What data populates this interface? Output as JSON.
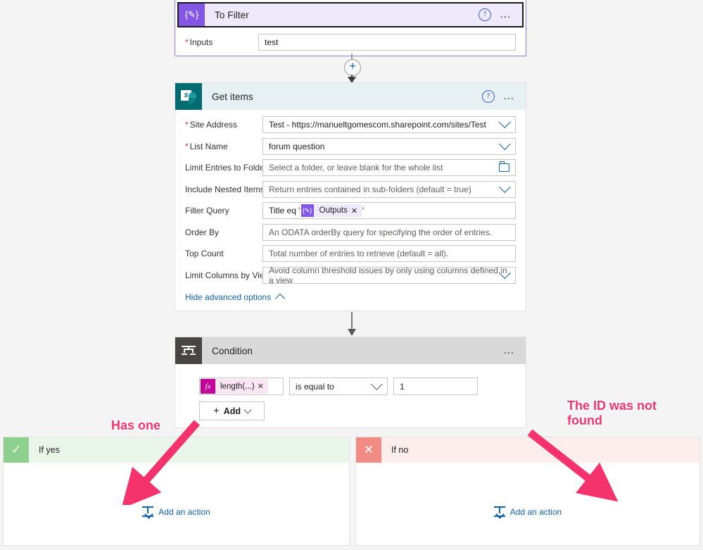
{
  "flow": {
    "steps": [
      {
        "id": "to-filter",
        "title": "To Filter",
        "icon": "compose-icon",
        "help_icon": "help-icon",
        "more_icon": "more-options-icon",
        "fields": [
          {
            "label": "Inputs",
            "required": true,
            "value": "test",
            "is_placeholder": false,
            "control": "text"
          }
        ]
      },
      {
        "id": "get-items",
        "title": "Get items",
        "icon": "sharepoint-icon",
        "help_icon": "help-icon",
        "more_icon": "more-options-icon",
        "fields": [
          {
            "label": "Site Address",
            "required": true,
            "value": "Test - https://manueltgomescom.sharepoint.com/sites/Test",
            "is_placeholder": false,
            "control": "dropdown"
          },
          {
            "label": "List Name",
            "required": true,
            "value": "forum question",
            "is_placeholder": false,
            "control": "dropdown"
          },
          {
            "label": "Limit Entries to Folder",
            "required": false,
            "value": "Select a folder, or leave blank for the whole list",
            "is_placeholder": true,
            "control": "folder-picker"
          },
          {
            "label": "Include Nested Items",
            "required": false,
            "value": "Return entries contained in sub-folders (default = true)",
            "is_placeholder": true,
            "control": "dropdown"
          },
          {
            "label": "Filter Query",
            "required": false,
            "control": "token-text",
            "prefix": "Title eq '",
            "token": {
              "label": "Outputs",
              "icon": "compose-icon",
              "remove_icon": "close-icon"
            },
            "suffix": "'"
          },
          {
            "label": "Order By",
            "required": false,
            "value": "An ODATA orderBy query for specifying the order of entries.",
            "is_placeholder": true,
            "control": "text"
          },
          {
            "label": "Top Count",
            "required": false,
            "value": "Total number of entries to retrieve (default = all).",
            "is_placeholder": true,
            "control": "text"
          },
          {
            "label": "Limit Columns by View",
            "required": false,
            "value": "Avoid column threshold issues by only using columns defined in a view",
            "is_placeholder": true,
            "control": "dropdown"
          }
        ],
        "advanced_toggle": "Hide advanced options"
      },
      {
        "id": "condition",
        "title": "Condition",
        "icon": "condition-icon",
        "more_icon": "more-options-icon",
        "expression": {
          "left": {
            "label": "length(...)",
            "icon": "fx-icon",
            "remove_icon": "close-icon"
          },
          "operator": "is equal to",
          "right": "1"
        },
        "add_button": "Add"
      }
    ],
    "branches": [
      {
        "id": "if-yes",
        "title": "If yes",
        "badge_icon": "check-icon",
        "add_action_label": "Add an action",
        "add_action_icon": "add-action-icon"
      },
      {
        "id": "if-no",
        "title": "If no",
        "badge_icon": "close-icon",
        "add_action_label": "Add an action",
        "add_action_icon": "add-action-icon"
      }
    ],
    "connectors": {
      "insert_label": "+",
      "insert_icon": "plus-icon",
      "arrow_icon": "arrow-down-icon"
    }
  },
  "annotations": [
    {
      "id": "has-one",
      "text": "Has one",
      "color": "#f4326c"
    },
    {
      "id": "id-not-found",
      "text": "The ID was not found",
      "color": "#f4326c"
    }
  ],
  "colors": {
    "accent_purple": "#8257e5",
    "sharepoint_teal": "#036c70",
    "condition_gray": "#484644",
    "link_blue": "#0f62b1",
    "annotation_pink": "#f4326c",
    "yes_green": "#8ed18e",
    "no_red": "#f08c84"
  }
}
